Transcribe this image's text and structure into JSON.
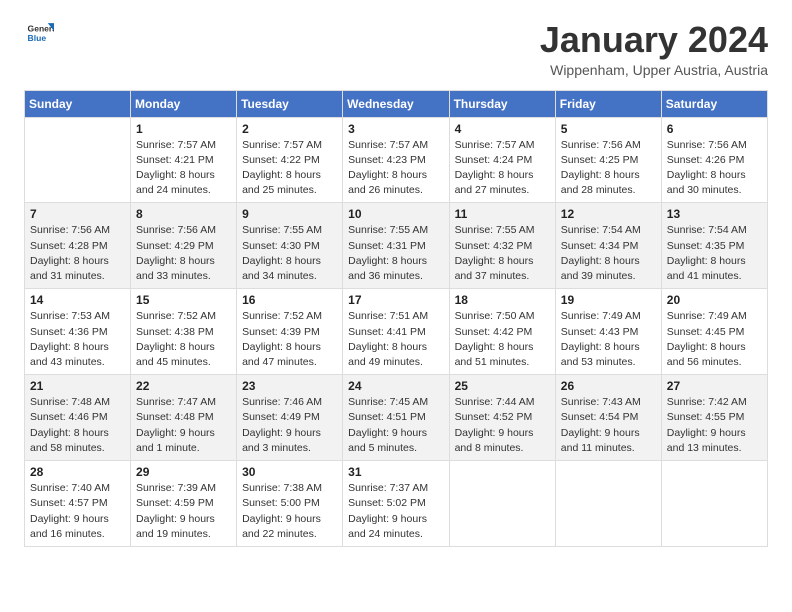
{
  "header": {
    "logo": {
      "general": "General",
      "blue": "Blue"
    },
    "title": "January 2024",
    "location": "Wippenham, Upper Austria, Austria"
  },
  "calendar": {
    "days_of_week": [
      "Sunday",
      "Monday",
      "Tuesday",
      "Wednesday",
      "Thursday",
      "Friday",
      "Saturday"
    ],
    "weeks": [
      [
        {
          "day": "",
          "info": ""
        },
        {
          "day": "1",
          "info": "Sunrise: 7:57 AM\nSunset: 4:21 PM\nDaylight: 8 hours\nand 24 minutes."
        },
        {
          "day": "2",
          "info": "Sunrise: 7:57 AM\nSunset: 4:22 PM\nDaylight: 8 hours\nand 25 minutes."
        },
        {
          "day": "3",
          "info": "Sunrise: 7:57 AM\nSunset: 4:23 PM\nDaylight: 8 hours\nand 26 minutes."
        },
        {
          "day": "4",
          "info": "Sunrise: 7:57 AM\nSunset: 4:24 PM\nDaylight: 8 hours\nand 27 minutes."
        },
        {
          "day": "5",
          "info": "Sunrise: 7:56 AM\nSunset: 4:25 PM\nDaylight: 8 hours\nand 28 minutes."
        },
        {
          "day": "6",
          "info": "Sunrise: 7:56 AM\nSunset: 4:26 PM\nDaylight: 8 hours\nand 30 minutes."
        }
      ],
      [
        {
          "day": "7",
          "info": "Sunrise: 7:56 AM\nSunset: 4:28 PM\nDaylight: 8 hours\nand 31 minutes."
        },
        {
          "day": "8",
          "info": "Sunrise: 7:56 AM\nSunset: 4:29 PM\nDaylight: 8 hours\nand 33 minutes."
        },
        {
          "day": "9",
          "info": "Sunrise: 7:55 AM\nSunset: 4:30 PM\nDaylight: 8 hours\nand 34 minutes."
        },
        {
          "day": "10",
          "info": "Sunrise: 7:55 AM\nSunset: 4:31 PM\nDaylight: 8 hours\nand 36 minutes."
        },
        {
          "day": "11",
          "info": "Sunrise: 7:55 AM\nSunset: 4:32 PM\nDaylight: 8 hours\nand 37 minutes."
        },
        {
          "day": "12",
          "info": "Sunrise: 7:54 AM\nSunset: 4:34 PM\nDaylight: 8 hours\nand 39 minutes."
        },
        {
          "day": "13",
          "info": "Sunrise: 7:54 AM\nSunset: 4:35 PM\nDaylight: 8 hours\nand 41 minutes."
        }
      ],
      [
        {
          "day": "14",
          "info": "Sunrise: 7:53 AM\nSunset: 4:36 PM\nDaylight: 8 hours\nand 43 minutes."
        },
        {
          "day": "15",
          "info": "Sunrise: 7:52 AM\nSunset: 4:38 PM\nDaylight: 8 hours\nand 45 minutes."
        },
        {
          "day": "16",
          "info": "Sunrise: 7:52 AM\nSunset: 4:39 PM\nDaylight: 8 hours\nand 47 minutes."
        },
        {
          "day": "17",
          "info": "Sunrise: 7:51 AM\nSunset: 4:41 PM\nDaylight: 8 hours\nand 49 minutes."
        },
        {
          "day": "18",
          "info": "Sunrise: 7:50 AM\nSunset: 4:42 PM\nDaylight: 8 hours\nand 51 minutes."
        },
        {
          "day": "19",
          "info": "Sunrise: 7:49 AM\nSunset: 4:43 PM\nDaylight: 8 hours\nand 53 minutes."
        },
        {
          "day": "20",
          "info": "Sunrise: 7:49 AM\nSunset: 4:45 PM\nDaylight: 8 hours\nand 56 minutes."
        }
      ],
      [
        {
          "day": "21",
          "info": "Sunrise: 7:48 AM\nSunset: 4:46 PM\nDaylight: 8 hours\nand 58 minutes."
        },
        {
          "day": "22",
          "info": "Sunrise: 7:47 AM\nSunset: 4:48 PM\nDaylight: 9 hours\nand 1 minute."
        },
        {
          "day": "23",
          "info": "Sunrise: 7:46 AM\nSunset: 4:49 PM\nDaylight: 9 hours\nand 3 minutes."
        },
        {
          "day": "24",
          "info": "Sunrise: 7:45 AM\nSunset: 4:51 PM\nDaylight: 9 hours\nand 5 minutes."
        },
        {
          "day": "25",
          "info": "Sunrise: 7:44 AM\nSunset: 4:52 PM\nDaylight: 9 hours\nand 8 minutes."
        },
        {
          "day": "26",
          "info": "Sunrise: 7:43 AM\nSunset: 4:54 PM\nDaylight: 9 hours\nand 11 minutes."
        },
        {
          "day": "27",
          "info": "Sunrise: 7:42 AM\nSunset: 4:55 PM\nDaylight: 9 hours\nand 13 minutes."
        }
      ],
      [
        {
          "day": "28",
          "info": "Sunrise: 7:40 AM\nSunset: 4:57 PM\nDaylight: 9 hours\nand 16 minutes."
        },
        {
          "day": "29",
          "info": "Sunrise: 7:39 AM\nSunset: 4:59 PM\nDaylight: 9 hours\nand 19 minutes."
        },
        {
          "day": "30",
          "info": "Sunrise: 7:38 AM\nSunset: 5:00 PM\nDaylight: 9 hours\nand 22 minutes."
        },
        {
          "day": "31",
          "info": "Sunrise: 7:37 AM\nSunset: 5:02 PM\nDaylight: 9 hours\nand 24 minutes."
        },
        {
          "day": "",
          "info": ""
        },
        {
          "day": "",
          "info": ""
        },
        {
          "day": "",
          "info": ""
        }
      ]
    ]
  }
}
